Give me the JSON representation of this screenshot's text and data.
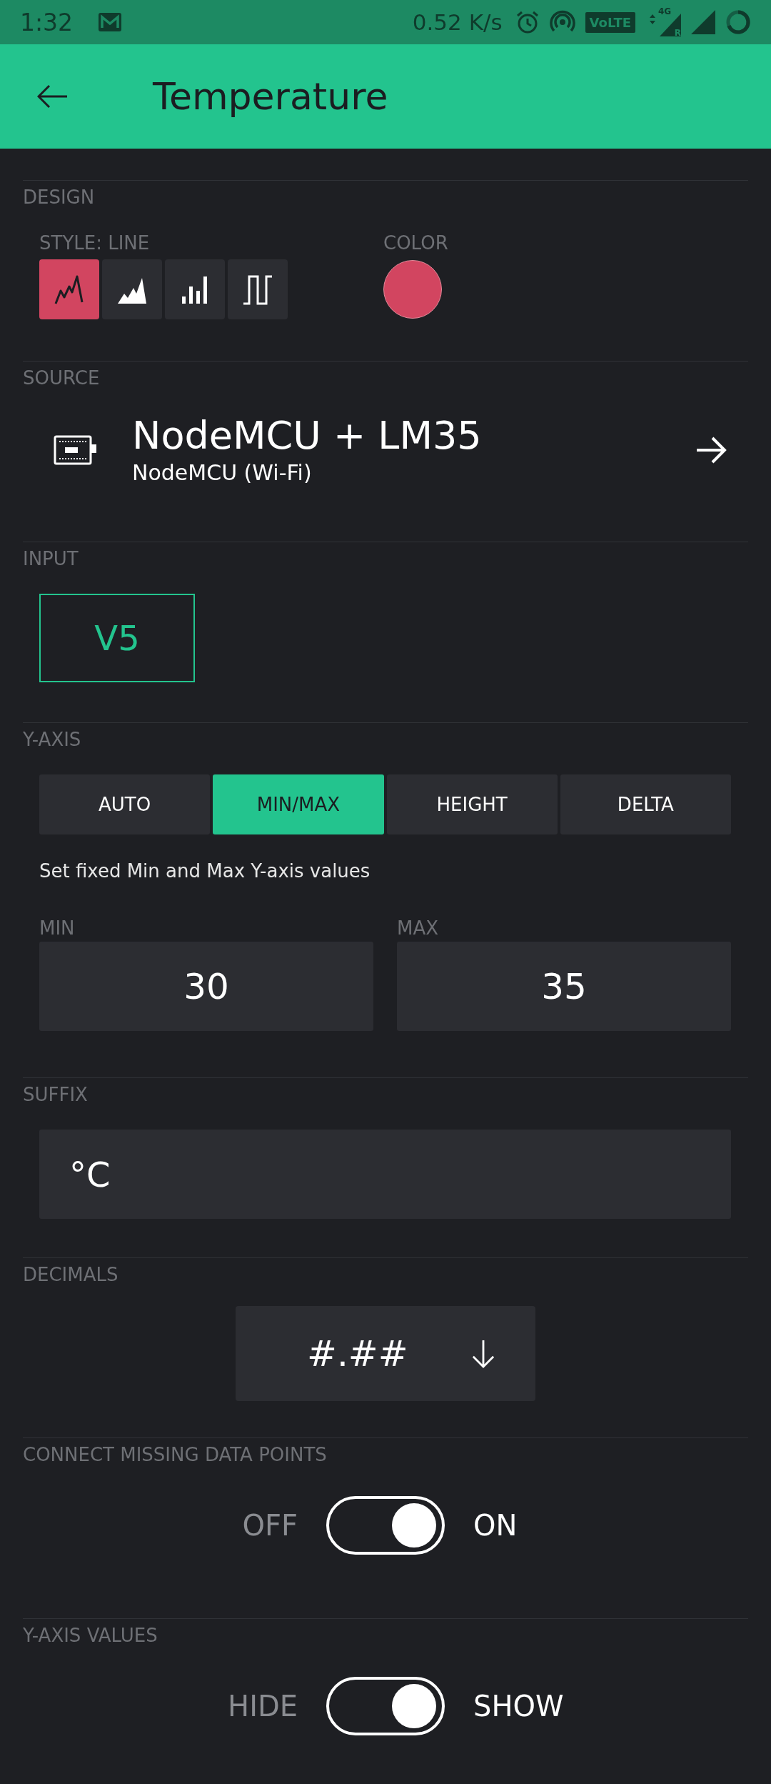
{
  "status_bar": {
    "time": "1:32",
    "speed": "0.52 K/s",
    "volte": "VoLTE",
    "network": "4G",
    "roaming": "R"
  },
  "header": {
    "title": "Temperature"
  },
  "design": {
    "label": "DESIGN",
    "style_label": "STYLE: LINE",
    "styles": [
      {
        "kind": "line",
        "selected": true
      },
      {
        "kind": "area",
        "selected": false
      },
      {
        "kind": "bars",
        "selected": false
      },
      {
        "kind": "step",
        "selected": false
      }
    ],
    "color_label": "COLOR",
    "color": "#d24560"
  },
  "source": {
    "label": "SOURCE",
    "name": "NodeMCU + LM35",
    "device": "NodeMCU (Wi-Fi)"
  },
  "input": {
    "label": "INPUT",
    "pin": "V5"
  },
  "y_axis": {
    "label": "Y-AXIS",
    "modes": [
      {
        "label": "AUTO",
        "selected": false
      },
      {
        "label": "MIN/MAX",
        "selected": true
      },
      {
        "label": "HEIGHT",
        "selected": false
      },
      {
        "label": "DELTA",
        "selected": false
      }
    ],
    "description": "Set fixed Min and Max Y-axis values",
    "min_label": "MIN",
    "min": "30",
    "max_label": "MAX",
    "max": "35"
  },
  "suffix": {
    "label": "SUFFIX",
    "value": "°C"
  },
  "decimals": {
    "label": "DECIMALS",
    "value": "#.##"
  },
  "toggles": [
    {
      "label": "CONNECT MISSING DATA POINTS",
      "off_text": "OFF",
      "on_text": "ON",
      "on": true
    },
    {
      "label": "Y-AXIS VALUES",
      "off_text": "HIDE",
      "on_text": "SHOW",
      "on": true
    }
  ]
}
